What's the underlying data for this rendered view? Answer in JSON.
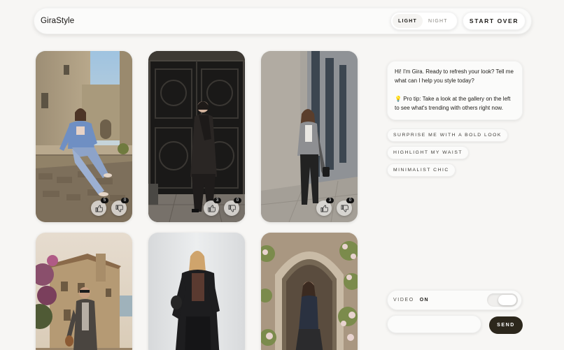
{
  "header": {
    "brand": "GiraStyle",
    "theme": {
      "light": "LIGHT",
      "night": "NIGHT",
      "active": "light"
    },
    "start_over": "START OVER"
  },
  "gallery": [
    {
      "name": "look-1",
      "scene": "stone-village-hoodie",
      "likes": "5",
      "dislikes": "0"
    },
    {
      "name": "look-2",
      "scene": "iron-door-black-coat",
      "likes": "3",
      "dislikes": "0"
    },
    {
      "name": "look-3",
      "scene": "concrete-wall-blazer",
      "likes": "3",
      "dislikes": "0"
    },
    {
      "name": "look-4",
      "scene": "seaside-village-jacket"
    },
    {
      "name": "look-5",
      "scene": "studio-black-suit"
    },
    {
      "name": "look-6",
      "scene": "stone-arch-roses"
    }
  ],
  "chat": {
    "greeting": "Hi! I'm Gira. Ready to refresh your look? Tell me what can I help you style today?",
    "tip_icon": "lightbulb-icon",
    "tip": "Pro tip: Take a look at the gallery on the left to see what's trending with others right now.",
    "suggestions": [
      "SURPRISE ME WITH A BOLD LOOK",
      "HIGHLIGHT MY WAIST",
      "MINIMALIST CHIC"
    ]
  },
  "controls": {
    "video_label": "VIDEO",
    "video_state": "ON",
    "message_placeholder": "",
    "send": "SEND"
  },
  "icons": {
    "like": "thumbs-up-icon",
    "dislike": "thumbs-down-icon"
  }
}
